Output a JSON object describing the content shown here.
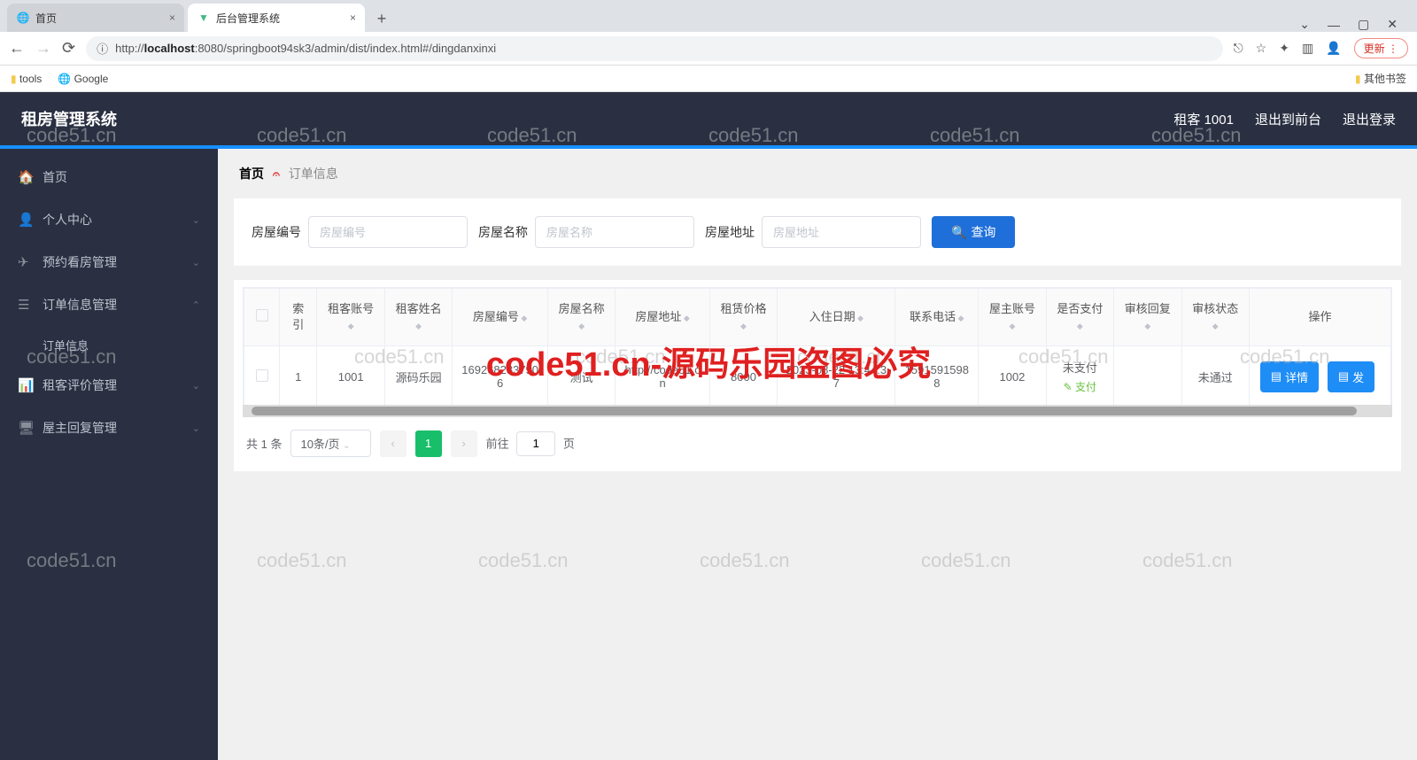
{
  "browser": {
    "tabs": [
      {
        "label": "首页",
        "favicon": "globe"
      },
      {
        "label": "后台管理系统",
        "favicon": "vue"
      }
    ],
    "url_prefix": "http://",
    "url_host": "localhost",
    "url_rest": ":8080/springboot94sk3/admin/dist/index.html#/dingdanxinxi",
    "bookmarks": {
      "tools": "tools",
      "google": "Google",
      "other": "其他书签"
    },
    "update": "更新"
  },
  "header": {
    "title": "租房管理系统",
    "user": "租客 1001",
    "to_front": "退出到前台",
    "logout": "退出登录"
  },
  "sidebar": {
    "items": [
      {
        "label": "首页",
        "icon": "home"
      },
      {
        "label": "个人中心",
        "icon": "user",
        "chev": true
      },
      {
        "label": "预约看房管理",
        "icon": "send",
        "chev": true
      },
      {
        "label": "订单信息管理",
        "icon": "list",
        "chev": true,
        "expanded": true,
        "children": [
          {
            "label": "订单信息",
            "active": true
          }
        ]
      },
      {
        "label": "租客评价管理",
        "icon": "chart",
        "chev": true
      },
      {
        "label": "屋主回复管理",
        "icon": "monitor",
        "chev": true
      }
    ]
  },
  "breadcrumb": {
    "home": "首页",
    "current": "订单信息"
  },
  "search": {
    "f1_label": "房屋编号",
    "f1_ph": "房屋编号",
    "f2_label": "房屋名称",
    "f2_ph": "房屋名称",
    "f3_label": "房屋地址",
    "f3_ph": "房屋地址",
    "query": "查询"
  },
  "table": {
    "headers": [
      "索引",
      "租客账号",
      "租客姓名",
      "房屋编号",
      "房屋名称",
      "房屋地址",
      "租赁价格",
      "入住日期",
      "联系电话",
      "屋主账号",
      "是否支付",
      "审核回复",
      "审核状态",
      "操作"
    ],
    "row": {
      "index": "1",
      "tenant_acc": "1001",
      "tenant_name": "源码乐园",
      "house_no": "1692682837906",
      "house_name": "测试",
      "house_addr": "http://code51.cn",
      "price": "8000",
      "checkin": "2023-08-22 13:44:37",
      "phone": "15915915988",
      "owner_acc": "1002",
      "pay_status": "未支付",
      "pay_action": "支付",
      "review_reply": "",
      "review_status": "未通过",
      "op_detail": "详情",
      "op_send": "发"
    }
  },
  "pagination": {
    "total": "共 1 条",
    "per_page": "10条/页",
    "page": "1",
    "goto_prefix": "前往",
    "goto_val": "1",
    "goto_suffix": "页"
  },
  "watermark": "code51.cn-源码乐园盗图必究",
  "wm_small": "code51.cn"
}
